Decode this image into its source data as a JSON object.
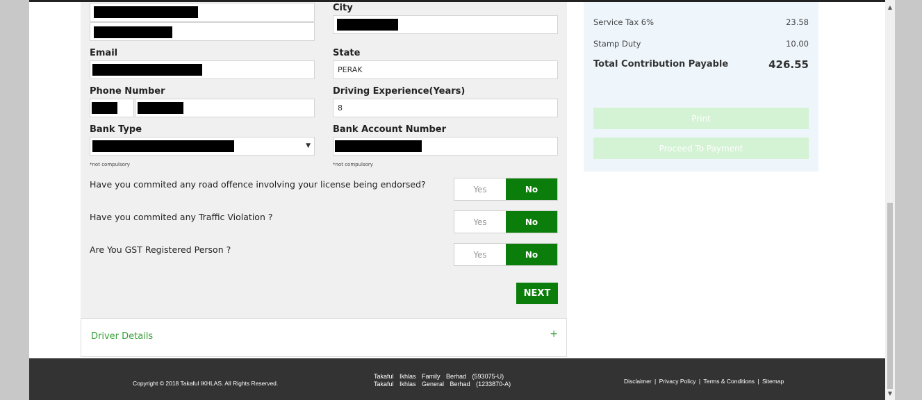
{
  "form": {
    "city_label": "City",
    "email_label": "Email",
    "state_label": "State",
    "state_value": "PERAK",
    "phone_label": "Phone Number",
    "driving_exp_label": "Driving Experience(Years)",
    "driving_exp_value": "8",
    "bank_type_label": "Bank Type",
    "bank_account_label": "Bank Account Number",
    "not_compulsory": "*not compulsory",
    "questions": [
      {
        "text": "Have you commited any road offence involving your license being endorsed?",
        "yes": "Yes",
        "no": "No",
        "selected": "No"
      },
      {
        "text": "Have you commited any Traffic Violation ?",
        "yes": "Yes",
        "no": "No",
        "selected": "No"
      },
      {
        "text": "Are You GST Registered Person ?",
        "yes": "Yes",
        "no": "No",
        "selected": "No"
      }
    ],
    "next_label": "NEXT"
  },
  "accordion": {
    "title": "Driver Details",
    "toggle": "+"
  },
  "summary": {
    "rows": [
      {
        "label": "Service Tax 6%",
        "value": "23.58"
      },
      {
        "label": "Stamp Duty",
        "value": "10.00"
      }
    ],
    "total_label": "Total Contribution Payable",
    "total_value": "426.55",
    "print_label": "Print",
    "proceed_label": "Proceed To Payment"
  },
  "footer": {
    "copyright": "Copyright © 2018 Takaful IKHLAS. All Rights Reserved.",
    "company_line1": "Takaful Ikhlas Family Berhad (593075-U)",
    "company_line2": "Takaful Ikhlas General Berhad (1233870-A)",
    "links": [
      "Disclaimer",
      "Privacy Policy",
      "Terms & Conditions",
      "Sitemap"
    ],
    "separator": "|"
  },
  "colors": {
    "accent": "#0a7d0a",
    "link_green": "#3aa03a",
    "footer_bg": "#333333",
    "summary_bg": "#eef6fc"
  }
}
